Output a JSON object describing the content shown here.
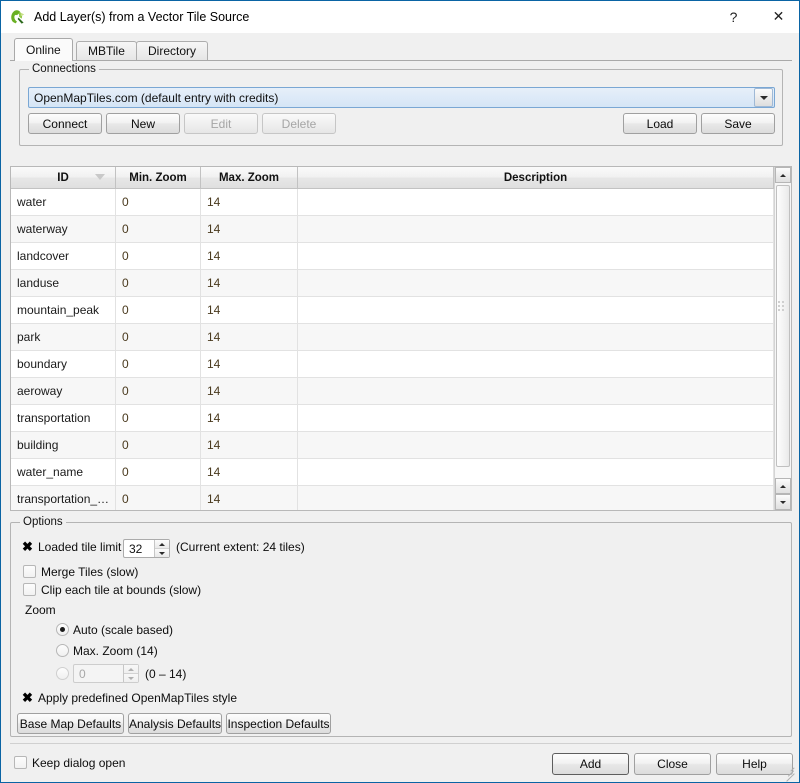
{
  "titlebar": {
    "title": "Add Layer(s) from a Vector Tile Source",
    "app_icon": "qgis-icon",
    "help_label": "?",
    "close_label": "✕"
  },
  "tabs": [
    {
      "label": "Online",
      "active": true
    },
    {
      "label": "MBTile",
      "active": false
    },
    {
      "label": "Directory",
      "active": false
    }
  ],
  "connections": {
    "group_title": "Connections",
    "combo_value": "OpenMapTiles.com (default entry with credits)",
    "buttons": [
      {
        "label": "Connect",
        "disabled": false
      },
      {
        "label": "New",
        "disabled": false
      },
      {
        "label": "Edit",
        "disabled": true
      },
      {
        "label": "Delete",
        "disabled": true
      },
      {
        "label": "Load",
        "disabled": false
      },
      {
        "label": "Save",
        "disabled": false
      }
    ]
  },
  "table": {
    "columns": [
      "ID",
      "Min. Zoom",
      "Max. Zoom",
      "Description"
    ],
    "sort_column": "ID",
    "rows": [
      {
        "id": "water",
        "min_zoom": "0",
        "max_zoom": "14",
        "description": ""
      },
      {
        "id": "waterway",
        "min_zoom": "0",
        "max_zoom": "14",
        "description": ""
      },
      {
        "id": "landcover",
        "min_zoom": "0",
        "max_zoom": "14",
        "description": ""
      },
      {
        "id": "landuse",
        "min_zoom": "0",
        "max_zoom": "14",
        "description": ""
      },
      {
        "id": "mountain_peak",
        "min_zoom": "0",
        "max_zoom": "14",
        "description": ""
      },
      {
        "id": "park",
        "min_zoom": "0",
        "max_zoom": "14",
        "description": ""
      },
      {
        "id": "boundary",
        "min_zoom": "0",
        "max_zoom": "14",
        "description": ""
      },
      {
        "id": "aeroway",
        "min_zoom": "0",
        "max_zoom": "14",
        "description": ""
      },
      {
        "id": "transportation",
        "min_zoom": "0",
        "max_zoom": "14",
        "description": ""
      },
      {
        "id": "building",
        "min_zoom": "0",
        "max_zoom": "14",
        "description": ""
      },
      {
        "id": "water_name",
        "min_zoom": "0",
        "max_zoom": "14",
        "description": ""
      },
      {
        "id": "transportation_…",
        "min_zoom": "0",
        "max_zoom": "14",
        "description": ""
      }
    ]
  },
  "options": {
    "group_title": "Options",
    "tile_limit": {
      "label": "Loaded tile limit",
      "checked": true,
      "value": "32",
      "hint": "(Current extent: 24 tiles)"
    },
    "merge_tiles": {
      "label": "Merge Tiles (slow)",
      "checked": false
    },
    "clip_tiles": {
      "label": "Clip each tile at bounds (slow)",
      "checked": false
    },
    "zoom": {
      "label": "Zoom",
      "radios": [
        {
          "label": "Auto (scale based)",
          "selected": true
        },
        {
          "label": "Max. Zoom (14)",
          "selected": false
        },
        {
          "label": "",
          "selected": false
        }
      ],
      "custom_value": "0",
      "custom_range": "(0 – 14)"
    },
    "apply_style": {
      "label": "Apply predefined OpenMapTiles style",
      "checked": true
    },
    "preset_buttons": [
      "Base Map Defaults",
      "Analysis Defaults",
      "Inspection Defaults"
    ]
  },
  "footer": {
    "keep_open": {
      "label": "Keep dialog open",
      "checked": false
    },
    "buttons": [
      {
        "label": "Add",
        "default": true
      },
      {
        "label": "Close",
        "default": false
      },
      {
        "label": "Help",
        "default": false
      }
    ]
  },
  "colors": {
    "window": "#f0f0f0",
    "border": "#0a64a4",
    "combo_highlight": "#d5e5f6",
    "accent_green": "#6ab023"
  }
}
